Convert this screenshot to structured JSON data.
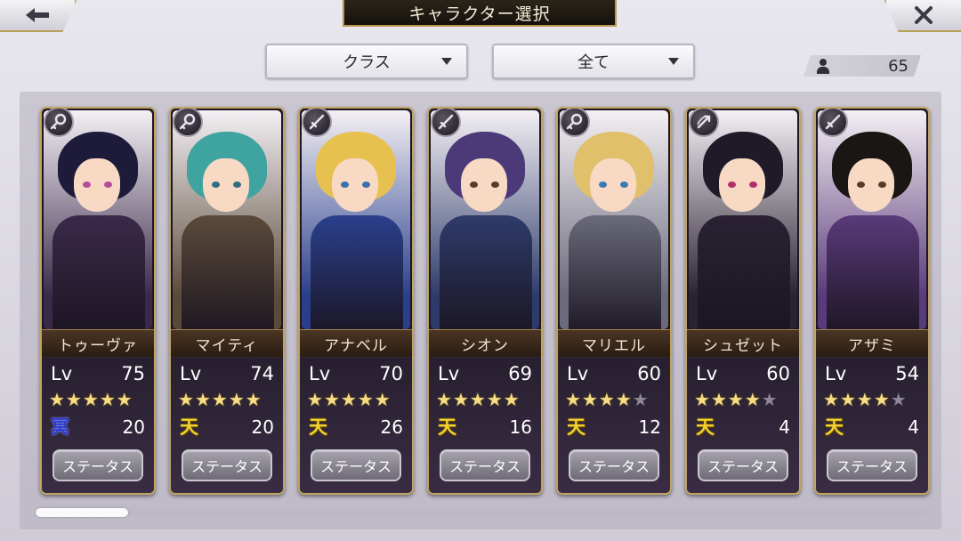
{
  "header": {
    "title": "キャラクター選択",
    "back_icon": "back-arrow-icon",
    "close_icon": "close-icon"
  },
  "filters": {
    "class_label": "クラス",
    "scope_label": "全て"
  },
  "count": {
    "icon": "person-icon",
    "value": "65"
  },
  "status_label": "ステータス",
  "lv_label": "Lv",
  "colors": {
    "frame_gold": "#bfa463",
    "star": "#f7dc85",
    "attr_ten": "#f3d12e",
    "attr_mei": "#2b3bd6"
  },
  "characters": [
    {
      "name": "トゥーヴァ",
      "level": "75",
      "stars": 5,
      "max_stars": 5,
      "attr": "冥",
      "attr_type": "mei",
      "value": "20",
      "class_icon": "key-icon",
      "hair": "#1e1a3a",
      "outfit": "#3a2a4a",
      "eye": "#b14f9a"
    },
    {
      "name": "マイティ",
      "level": "74",
      "stars": 5,
      "max_stars": 5,
      "attr": "天",
      "attr_type": "ten",
      "value": "20",
      "class_icon": "key-icon",
      "hair": "#3fa3a0",
      "outfit": "#5a4a3a",
      "eye": "#2e6e80"
    },
    {
      "name": "アナベル",
      "level": "70",
      "stars": 5,
      "max_stars": 5,
      "attr": "天",
      "attr_type": "ten",
      "value": "26",
      "class_icon": "sword-icon",
      "hair": "#e7c14f",
      "outfit": "#2a3f8c",
      "eye": "#3c6fb0"
    },
    {
      "name": "シオン",
      "level": "69",
      "stars": 5,
      "max_stars": 5,
      "attr": "天",
      "attr_type": "ten",
      "value": "16",
      "class_icon": "sword-icon",
      "hair": "#4c3a78",
      "outfit": "#2e3b6a",
      "eye": "#5a3a2a"
    },
    {
      "name": "マリエル",
      "level": "60",
      "stars": 4,
      "max_stars": 5,
      "attr": "天",
      "attr_type": "ten",
      "value": "12",
      "class_icon": "key-icon",
      "hair": "#e0c06a",
      "outfit": "#6a6a7a",
      "eye": "#3a7ab0"
    },
    {
      "name": "シュゼット",
      "level": "60",
      "stars": 4,
      "max_stars": 5,
      "attr": "天",
      "attr_type": "ten",
      "value": "4",
      "class_icon": "bow-icon",
      "hair": "#1e1a28",
      "outfit": "#2a2232",
      "eye": "#b0306a"
    },
    {
      "name": "アザミ",
      "level": "54",
      "stars": 4,
      "max_stars": 5,
      "attr": "天",
      "attr_type": "ten",
      "value": "4",
      "class_icon": "sword-icon",
      "hair": "#1a1614",
      "outfit": "#5a3a7a",
      "eye": "#5a3a28"
    }
  ]
}
